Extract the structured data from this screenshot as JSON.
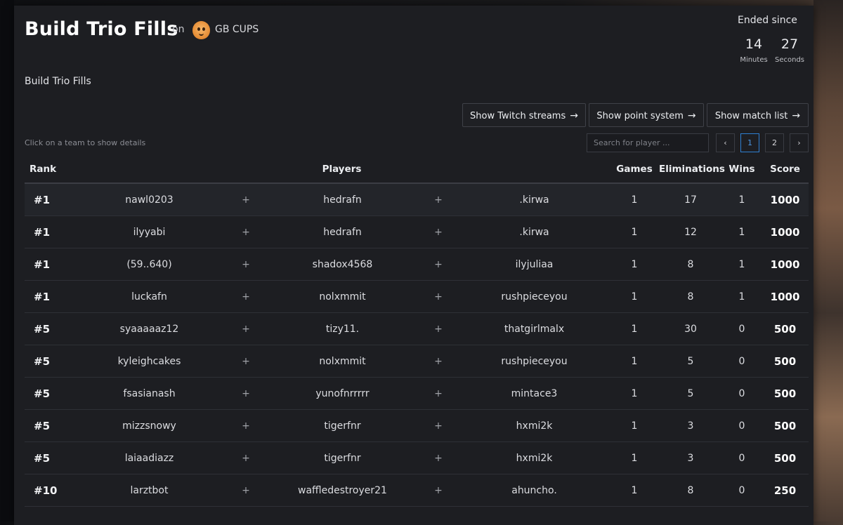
{
  "header": {
    "title": "Build Trio Fills",
    "on_label": "on",
    "organizer": "GB CUPS",
    "subtitle": "Build Trio Fills"
  },
  "countdown": {
    "label": "Ended since",
    "minutes": "14",
    "minutes_label": "Minutes",
    "seconds": "27",
    "seconds_label": "Seconds"
  },
  "toolbar": {
    "twitch_label": "Show Twitch streams",
    "points_label": "Show point system",
    "matches_label": "Show match list",
    "arrow": "→"
  },
  "hint": "Click on a team to show details",
  "search": {
    "placeholder": "Search for player ..."
  },
  "pagination": {
    "prev": "‹",
    "pages": [
      "1",
      "2"
    ],
    "next": "›",
    "current": "1"
  },
  "table": {
    "headers": {
      "rank": "Rank",
      "players": "Players",
      "games": "Games",
      "eliminations": "Eliminations",
      "wins": "Wins",
      "score": "Score"
    },
    "separator": "+",
    "rows": [
      {
        "rank": "#1",
        "p1": "nawl0203",
        "p2": "hedrafn",
        "p3": ".kirwa",
        "games": "1",
        "elims": "17",
        "wins": "1",
        "score": "1000"
      },
      {
        "rank": "#1",
        "p1": "ilyyabi",
        "p2": "hedrafn",
        "p3": ".kirwa",
        "games": "1",
        "elims": "12",
        "wins": "1",
        "score": "1000"
      },
      {
        "rank": "#1",
        "p1": "(59..640)",
        "p2": "shadox4568",
        "p3": "ilyjuliaa",
        "games": "1",
        "elims": "8",
        "wins": "1",
        "score": "1000"
      },
      {
        "rank": "#1",
        "p1": "luckafn",
        "p2": "nolxmmit",
        "p3": "rushpieceyou",
        "games": "1",
        "elims": "8",
        "wins": "1",
        "score": "1000"
      },
      {
        "rank": "#5",
        "p1": "syaaaaaz12",
        "p2": "tizy11.",
        "p3": "thatgirlmalx",
        "games": "1",
        "elims": "30",
        "wins": "0",
        "score": "500"
      },
      {
        "rank": "#5",
        "p1": "kyleighcakes",
        "p2": "nolxmmit",
        "p3": "rushpieceyou",
        "games": "1",
        "elims": "5",
        "wins": "0",
        "score": "500"
      },
      {
        "rank": "#5",
        "p1": "fsasianash",
        "p2": "yunofnrrrrr",
        "p3": "mintace3",
        "games": "1",
        "elims": "5",
        "wins": "0",
        "score": "500"
      },
      {
        "rank": "#5",
        "p1": "mizzsnowy",
        "p2": "tigerfnr",
        "p3": "hxmi2k",
        "games": "1",
        "elims": "3",
        "wins": "0",
        "score": "500"
      },
      {
        "rank": "#5",
        "p1": "laiaadiazz",
        "p2": "tigerfnr",
        "p3": "hxmi2k",
        "games": "1",
        "elims": "3",
        "wins": "0",
        "score": "500"
      },
      {
        "rank": "#10",
        "p1": "larztbot",
        "p2": "waffledestroyer21",
        "p3": "ahuncho.",
        "games": "1",
        "elims": "8",
        "wins": "0",
        "score": "250"
      }
    ]
  }
}
